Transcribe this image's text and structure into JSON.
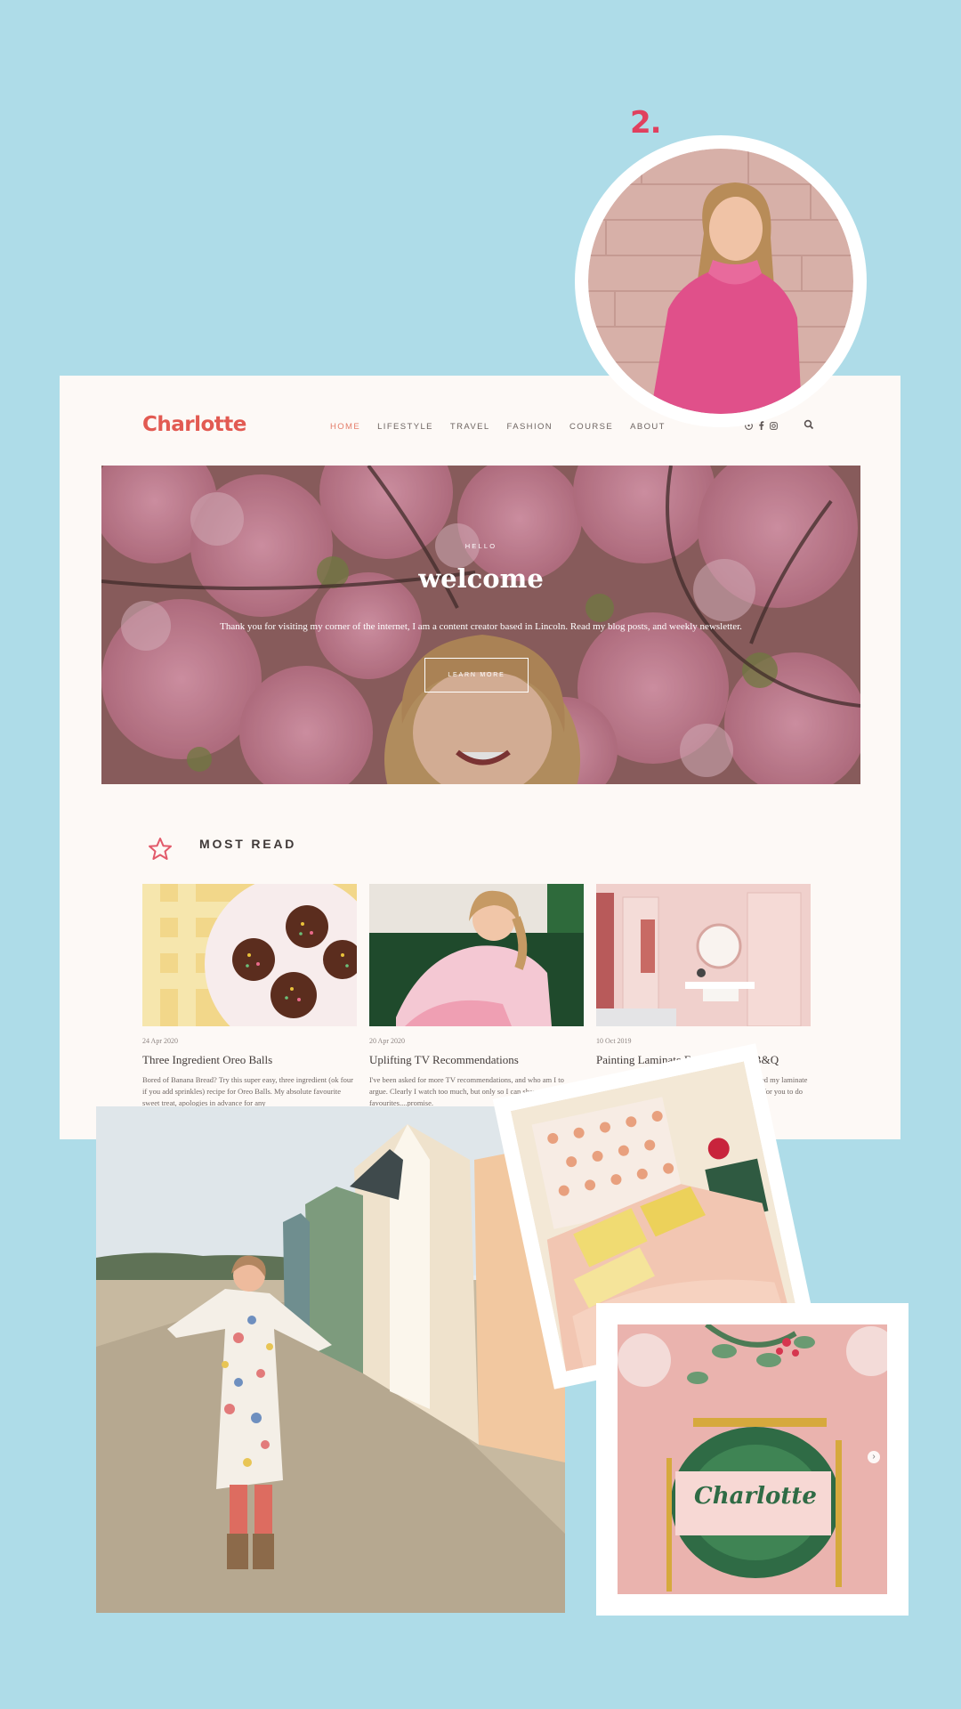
{
  "step": {
    "number": "2."
  },
  "site": {
    "logo": "Charlotte",
    "nav": {
      "items": [
        {
          "label": "HOME",
          "active": true
        },
        {
          "label": "LIFESTYLE"
        },
        {
          "label": "TRAVEL"
        },
        {
          "label": "FASHION"
        },
        {
          "label": "COURSE"
        },
        {
          "label": "ABOUT"
        }
      ],
      "social_icons": [
        "pinterest-icon",
        "facebook-icon",
        "instagram-icon"
      ],
      "search_icon": "search-icon"
    },
    "hero": {
      "eyebrow": "HELLO",
      "title": "welcome",
      "subtitle": "Thank you for visiting my corner of the internet, I am a content creator based in Lincoln. Read my blog posts, and weekly newsletter.",
      "button": "LEARN MORE"
    },
    "most_read": {
      "heading": "MOST READ",
      "icon": "star-icon",
      "posts": [
        {
          "date": "24 Apr 2020",
          "title": "Three Ingredient Oreo Balls",
          "excerpt": "Bored of Banana Bread? Try this super easy, three ingredient (ok four if you add sprinkles) recipe for Oreo Balls. My absolute favourite sweet treat, apologies in advance for any"
        },
        {
          "date": "20 Apr 2020",
          "title": "Uplifting TV Recommendations",
          "excerpt": "I've been asked for more TV recommendations, and who am I to argue. Clearly I watch too much, but only so I can share with you my favourites....promise."
        },
        {
          "date": "10 Oct 2019",
          "title": "Painting Laminate Furniture with B&Q",
          "excerpt": "I've partnered with B&Q to show you how I transformed my laminate wardrobes into a pink paradise, and how easy it can be for you to do"
        }
      ]
    }
  },
  "photos": {
    "table_card_text": "Charlotte",
    "colors": {
      "background": "#aedce8",
      "accent": "#e0405e",
      "logo": "#e25a52"
    }
  }
}
